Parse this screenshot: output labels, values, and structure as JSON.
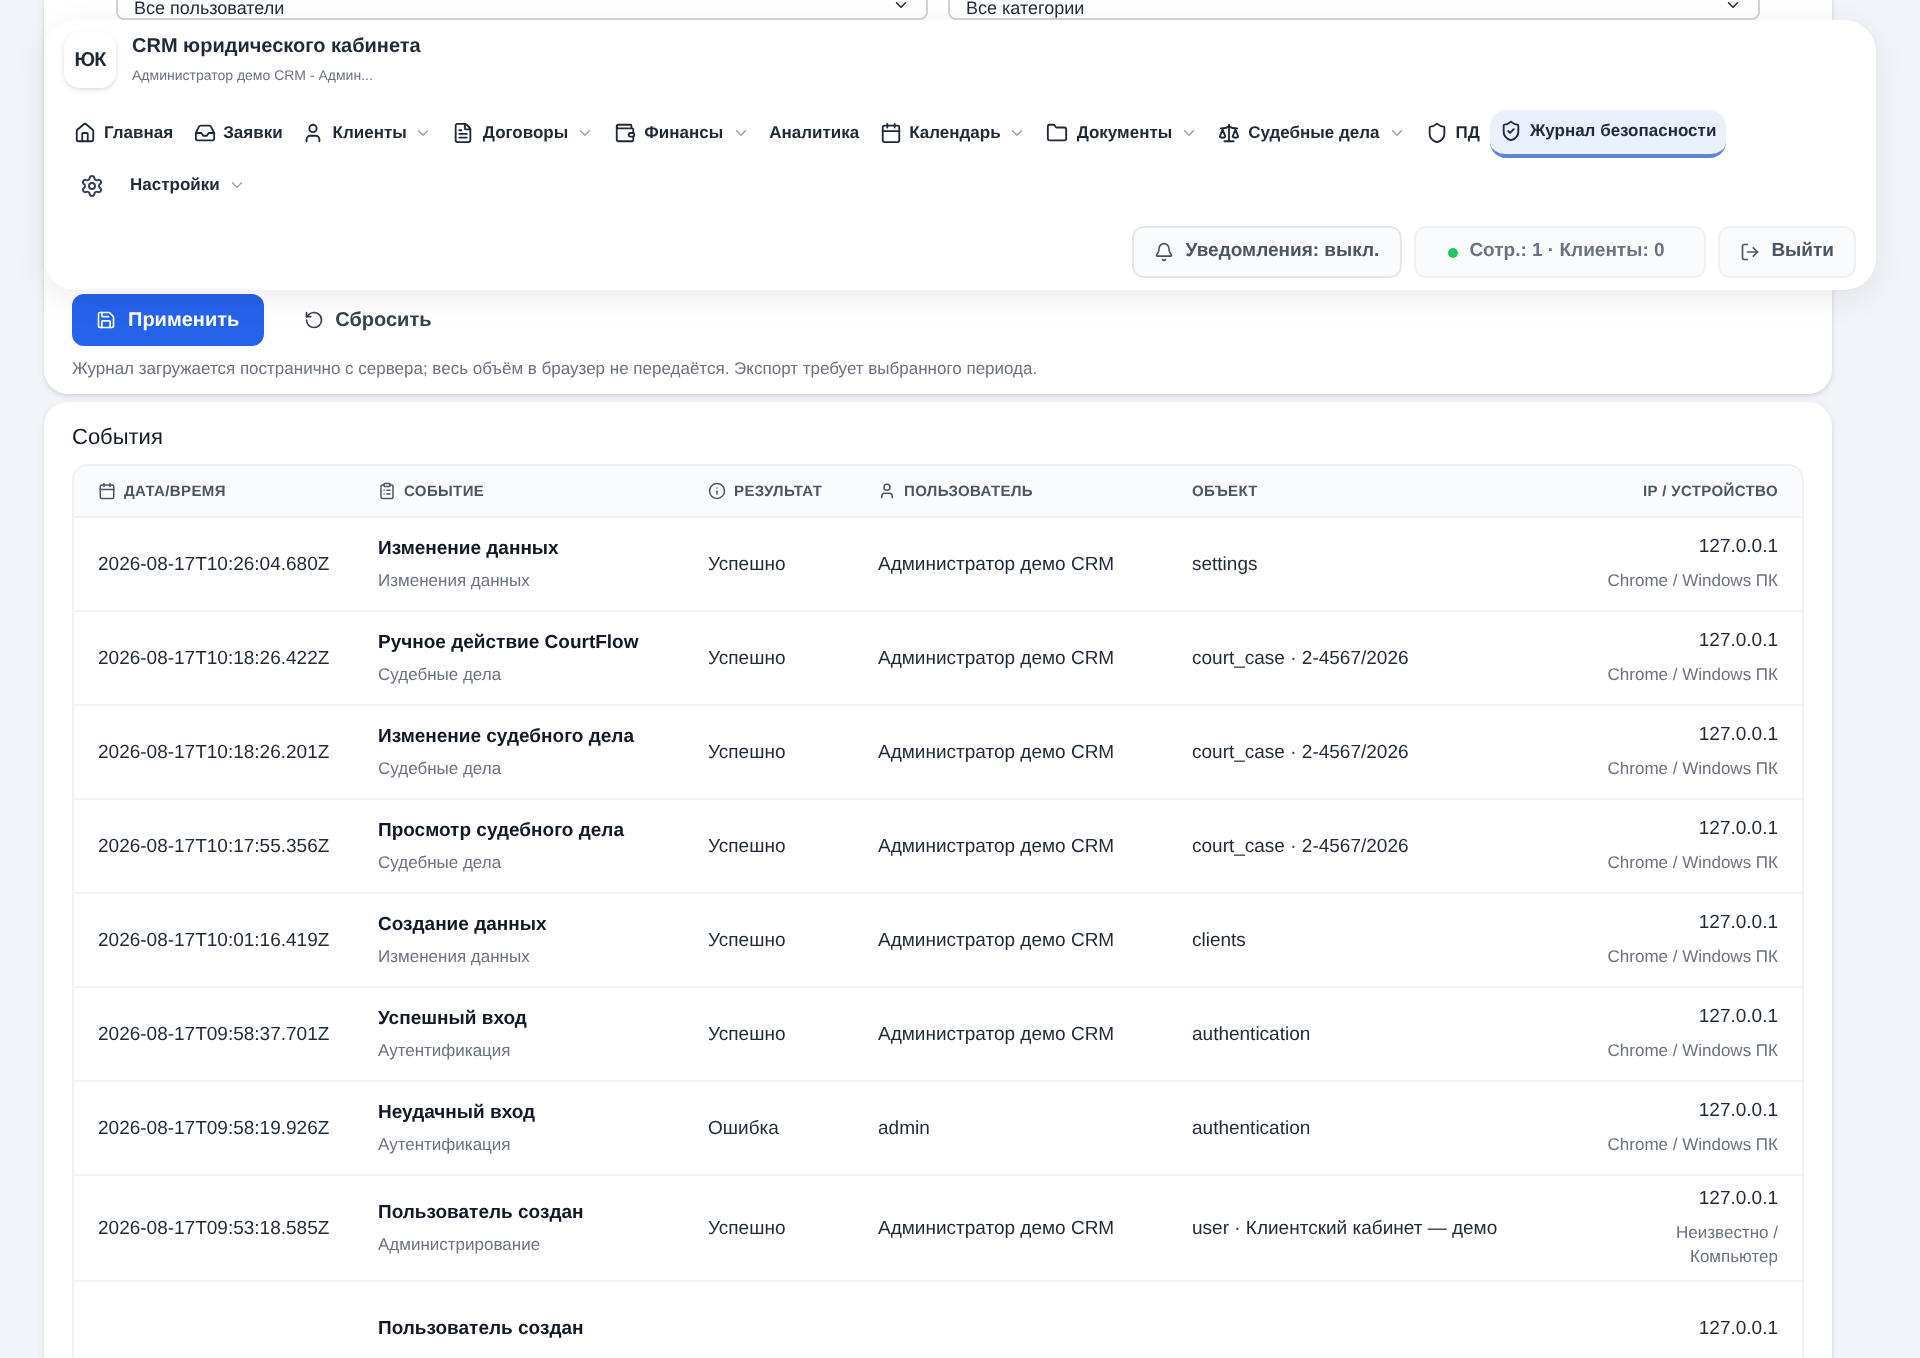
{
  "filters": {
    "selects": [
      {
        "value": "Все пользователи"
      },
      {
        "value": "Все категории"
      }
    ],
    "apply_button": "Применить",
    "reset_button": "Сбросить",
    "note": "Журнал загружается постранично с сервера; весь объём в браузер не передаётся. Экспорт требует выбранного периода."
  },
  "header": {
    "logo": "ЮК",
    "title": "CRM юридического кабинета",
    "subtitle": "Администратор демо CRM - Админ...",
    "nav": [
      {
        "kind": "link",
        "label": "Главная",
        "dropdown": false,
        "selected": false
      },
      {
        "kind": "link",
        "label": "Заявки",
        "dropdown": false,
        "selected": false
      },
      {
        "kind": "link",
        "label": "Клиенты",
        "dropdown": true,
        "selected": false
      },
      {
        "kind": "link",
        "label": "Договоры",
        "dropdown": true,
        "selected": false
      },
      {
        "kind": "link",
        "label": "Финансы",
        "dropdown": true,
        "selected": false
      },
      {
        "kind": "link",
        "label": "Аналитика",
        "dropdown": false,
        "selected": false
      },
      {
        "kind": "link",
        "label": "Календарь",
        "dropdown": true,
        "selected": false
      },
      {
        "kind": "link",
        "label": "Документы",
        "dropdown": true,
        "selected": false
      },
      {
        "kind": "link",
        "label": "Судебные дела",
        "dropdown": true,
        "selected": false
      },
      {
        "kind": "link",
        "label": "ПД",
        "dropdown": false,
        "selected": false
      },
      {
        "kind": "link",
        "label": "Журнал безопасности",
        "dropdown": false,
        "selected": true
      },
      {
        "kind": "icon-only",
        "selected": false
      },
      {
        "kind": "link",
        "label": "Настройки",
        "dropdown": true,
        "selected": false
      }
    ],
    "notifications_button": "Уведомления: выкл.",
    "status": {
      "text": "Сотр.: 1 · Клиенты: 0",
      "color": "#22c55e"
    },
    "logout_button": "Выйти"
  },
  "events": {
    "title": "События",
    "columns": [
      "ДАТА/ВРЕМЯ",
      "СОБЫТИЕ",
      "РЕЗУЛЬТАТ",
      "ПОЛЬЗОВАТЕЛЬ",
      "ОБЪЕКТ",
      "IP / УСТРОЙСТВО"
    ],
    "rows": [
      {
        "datetime": "2026-08-17T10:26:04.680Z",
        "event": "Изменение данных",
        "category": "Изменения данных",
        "result": "Успешно",
        "user": "Администратор демо CRM",
        "object": "settings",
        "ip": "127.0.0.1",
        "device": "Chrome / Windows ПК"
      },
      {
        "datetime": "2026-08-17T10:18:26.422Z",
        "event": "Ручное действие CourtFlow",
        "category": "Судебные дела",
        "result": "Успешно",
        "user": "Администратор демо CRM",
        "object": "court_case · 2-4567/2026",
        "ip": "127.0.0.1",
        "device": "Chrome / Windows ПК"
      },
      {
        "datetime": "2026-08-17T10:18:26.201Z",
        "event": "Изменение судебного дела",
        "category": "Судебные дела",
        "result": "Успешно",
        "user": "Администратор демо CRM",
        "object": "court_case · 2-4567/2026",
        "ip": "127.0.0.1",
        "device": "Chrome / Windows ПК"
      },
      {
        "datetime": "2026-08-17T10:17:55.356Z",
        "event": "Просмотр судебного дела",
        "category": "Судебные дела",
        "result": "Успешно",
        "user": "Администратор демо CRM",
        "object": "court_case · 2-4567/2026",
        "ip": "127.0.0.1",
        "device": "Chrome / Windows ПК"
      },
      {
        "datetime": "2026-08-17T10:01:16.419Z",
        "event": "Создание данных",
        "category": "Изменения данных",
        "result": "Успешно",
        "user": "Администратор демо CRM",
        "object": "clients",
        "ip": "127.0.0.1",
        "device": "Chrome / Windows ПК"
      },
      {
        "datetime": "2026-08-17T09:58:37.701Z",
        "event": "Успешный вход",
        "category": "Аутентификация",
        "result": "Успешно",
        "user": "Администратор демо CRM",
        "object": "authentication",
        "ip": "127.0.0.1",
        "device": "Chrome / Windows ПК"
      },
      {
        "datetime": "2026-08-17T09:58:19.926Z",
        "event": "Неудачный вход",
        "category": "Аутентификация",
        "result": "Ошибка",
        "user": "admin",
        "object": "authentication",
        "ip": "127.0.0.1",
        "device": "Chrome / Windows ПК"
      },
      {
        "datetime": "2026-08-17T09:53:18.585Z",
        "event": "Пользователь создан",
        "category": "Администрирование",
        "result": "Успешно",
        "user": "Администратор демо CRM",
        "object": "user · Клиентский кабинет — демо",
        "ip": "127.0.0.1",
        "device": "Неизвестно / Компьютер"
      },
      {
        "event": "Пользователь создан",
        "ip": "127.0.0.1"
      }
    ]
  }
}
